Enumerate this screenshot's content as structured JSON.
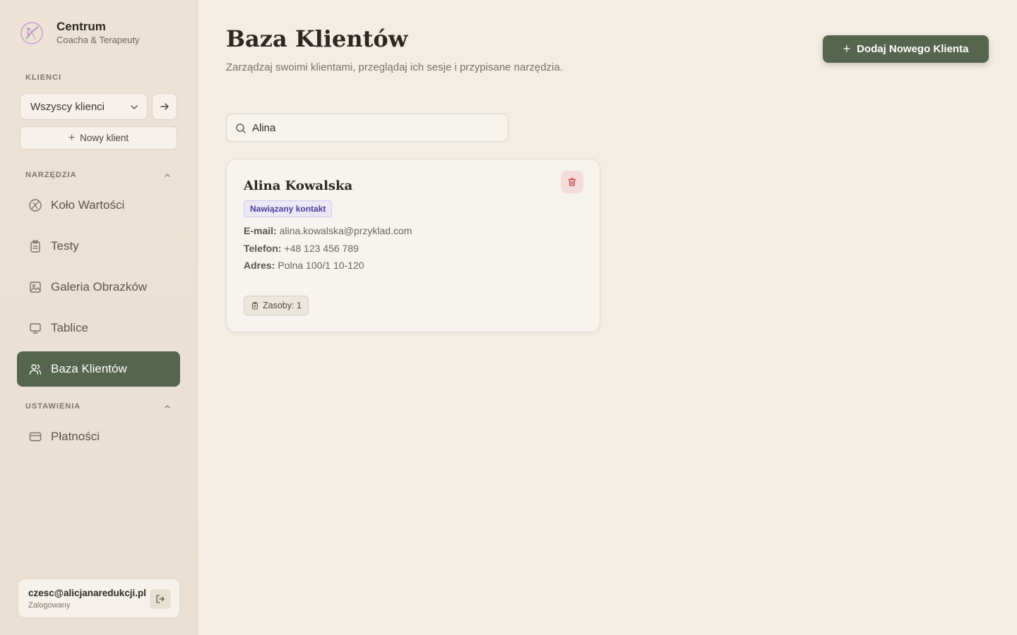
{
  "brand": {
    "title": "Centrum",
    "subtitle": "Coacha & Terapeuty"
  },
  "sidebar": {
    "clients_section": "KLIENCI",
    "client_select_value": "Wszyscy klienci",
    "new_client_label": "Nowy klient",
    "tools_section": "NARZĘDZIA",
    "tools": [
      {
        "label": "Koło Wartości",
        "icon": "value-wheel-icon"
      },
      {
        "label": "Testy",
        "icon": "clipboard-icon"
      },
      {
        "label": "Galeria Obrazków",
        "icon": "image-icon"
      },
      {
        "label": "Tablice",
        "icon": "board-icon"
      },
      {
        "label": "Baza Klientów",
        "icon": "users-icon",
        "active": true
      }
    ],
    "settings_section": "USTAWIENIA",
    "settings": [
      {
        "label": "Płatności",
        "icon": "credit-card-icon"
      }
    ]
  },
  "user": {
    "email": "czesc@alicjanaredukcji.pl",
    "status": "Zalogowany"
  },
  "main": {
    "title": "Baza Klientów",
    "subtitle": "Zarządzaj swoimi klientami, przeglądaj ich sesje i przypisane narzędzia.",
    "add_button_label": "Dodaj Nowego Klienta",
    "search_value": "Alina"
  },
  "client": {
    "name": "Alina Kowalska",
    "status": "Nawiązany kontakt",
    "email_label": "E-mail:",
    "email": "alina.kowalska@przyklad.com",
    "phone_label": "Telefon:",
    "phone": "+48 123 456 789",
    "address_label": "Adres:",
    "address": "Polna 100/1 10-120",
    "resources": "Zasoby: 1"
  },
  "colors": {
    "accent": "#56654d",
    "background": "#f3ede4",
    "sidebar": "#ece3d6",
    "badge_text": "#4a3f9a",
    "danger": "#c94a4a"
  }
}
